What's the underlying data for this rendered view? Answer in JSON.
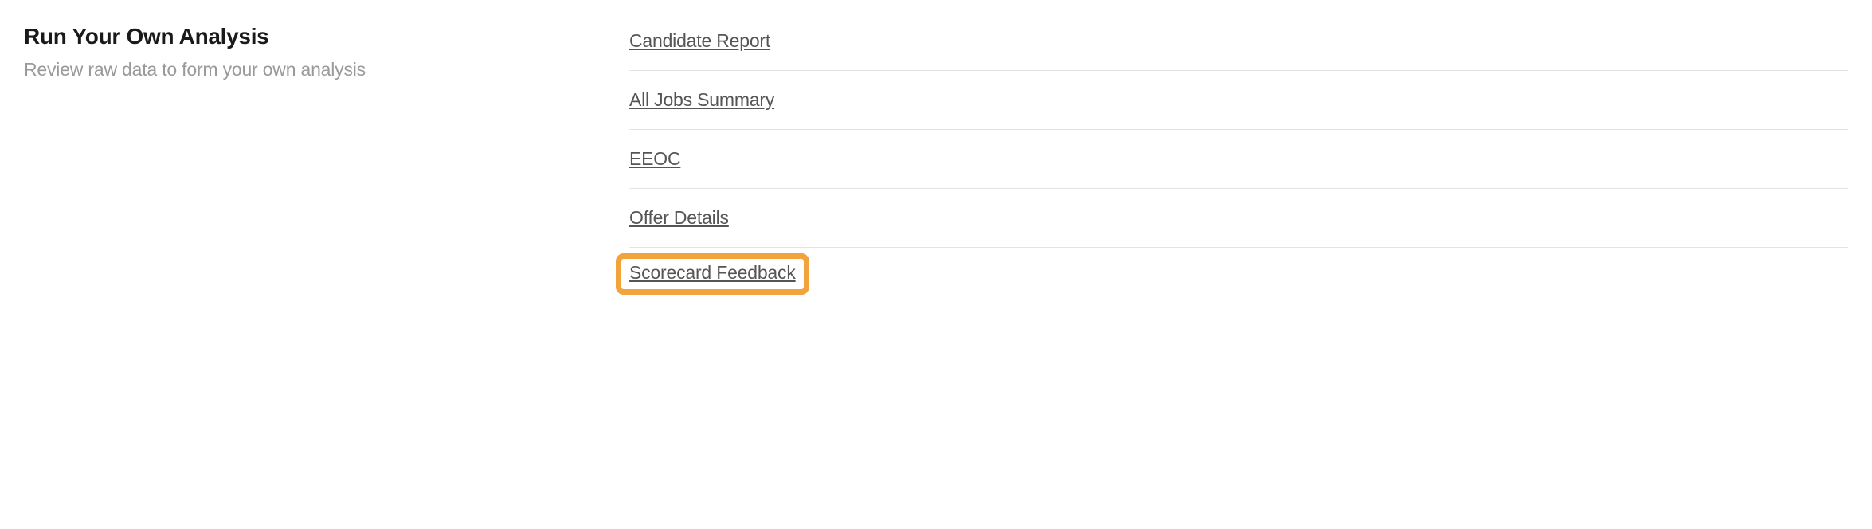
{
  "section": {
    "title": "Run Your Own Analysis",
    "subtitle": "Review raw data to form your own analysis"
  },
  "links": [
    {
      "label": "Candidate Report"
    },
    {
      "label": "All Jobs Summary"
    },
    {
      "label": "EEOC"
    },
    {
      "label": "Offer Details"
    },
    {
      "label": "Scorecard Feedback"
    }
  ]
}
